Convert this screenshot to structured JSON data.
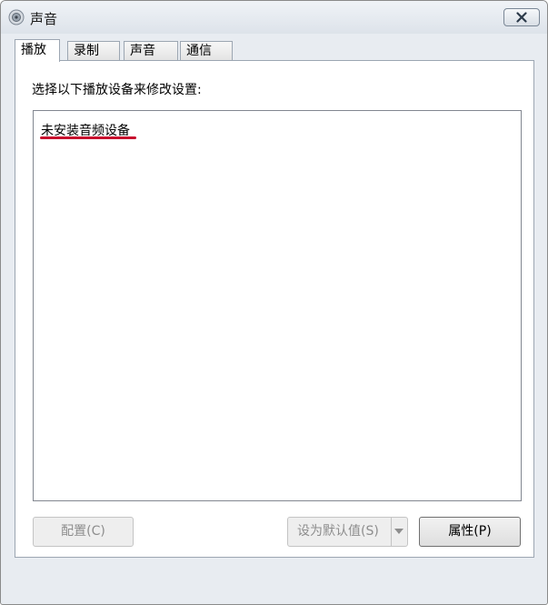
{
  "window": {
    "title": "声音",
    "close_icon": "close-icon",
    "app_icon": "speaker-icon"
  },
  "tabs": [
    {
      "label": "播放",
      "active": true
    },
    {
      "label": "录制",
      "active": false
    },
    {
      "label": "声音",
      "active": false
    },
    {
      "label": "通信",
      "active": false
    }
  ],
  "playback": {
    "instruction": "选择以下播放设备来修改设置:",
    "empty_message": "未安装音频设备",
    "highlight_color": "#c8102e"
  },
  "buttons": {
    "configure": "配置(C)",
    "set_default": "设为默认值(S)",
    "properties": "属性(P)"
  }
}
